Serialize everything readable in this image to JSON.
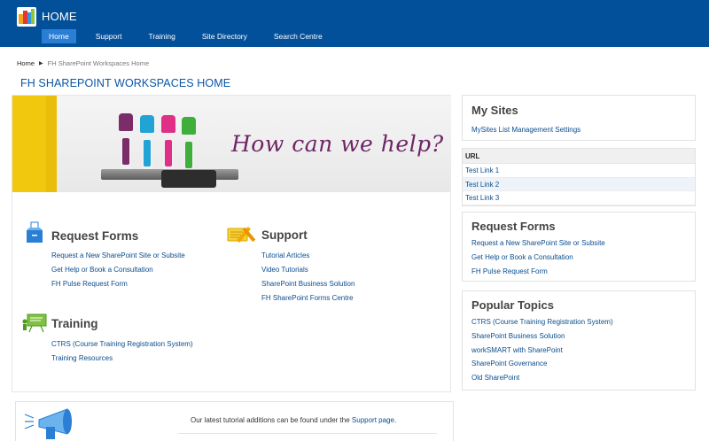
{
  "suite": {
    "title": "HOME",
    "nav": [
      "Home",
      "Support",
      "Training",
      "Site Directory",
      "Search Centre"
    ],
    "active_index": 0
  },
  "breadcrumb": {
    "root": "Home",
    "current": "FH SharePoint Workspaces Home"
  },
  "page_title": "FH SHAREPOINT WORKSPACES HOME",
  "hero": {
    "text": "How can we help?"
  },
  "sections": {
    "request_forms": {
      "title": "Request Forms",
      "icon": "ballot-box-icon",
      "links": [
        "Request a New SharePoint Site or Subsite",
        "Get Help or Book a Consultation",
        "FH Pulse Request Form"
      ]
    },
    "support": {
      "title": "Support",
      "icon": "tools-icon",
      "links": [
        "Tutorial Articles",
        "Video Tutorials",
        "SharePoint Business Solution",
        "FH SharePoint Forms Centre"
      ]
    },
    "training": {
      "title": "Training",
      "icon": "presentation-board-icon",
      "links": [
        "CTRS (Course Training Registration System)",
        "Training Resources"
      ]
    }
  },
  "my_sites": {
    "title": "My Sites",
    "link": "MySites List Management Settings"
  },
  "url_table": {
    "header": "URL",
    "rows": [
      "Test Link 1",
      "Test Link 2",
      "Test Link 3"
    ]
  },
  "right_request_forms": {
    "title": "Request Forms",
    "links": [
      "Request a New SharePoint Site or Subsite",
      "Get Help or Book a Consultation",
      "FH Pulse Request Form"
    ]
  },
  "popular_topics": {
    "title": "Popular Topics",
    "links": [
      "CTRS (Course Training Registration System)",
      "SharePoint Business Solution",
      "workSMART with SharePoint",
      "SharePoint Governance",
      "Old SharePoint"
    ]
  },
  "bottom": {
    "text_before": "Our latest tutorial additions can be found under the ",
    "link": "Support page",
    "text_after": "."
  },
  "colors": {
    "suite_bar": "#03509a",
    "active_tab": "#2a7fd4",
    "link": "#0a4d8f",
    "title": "#0a56a6"
  }
}
